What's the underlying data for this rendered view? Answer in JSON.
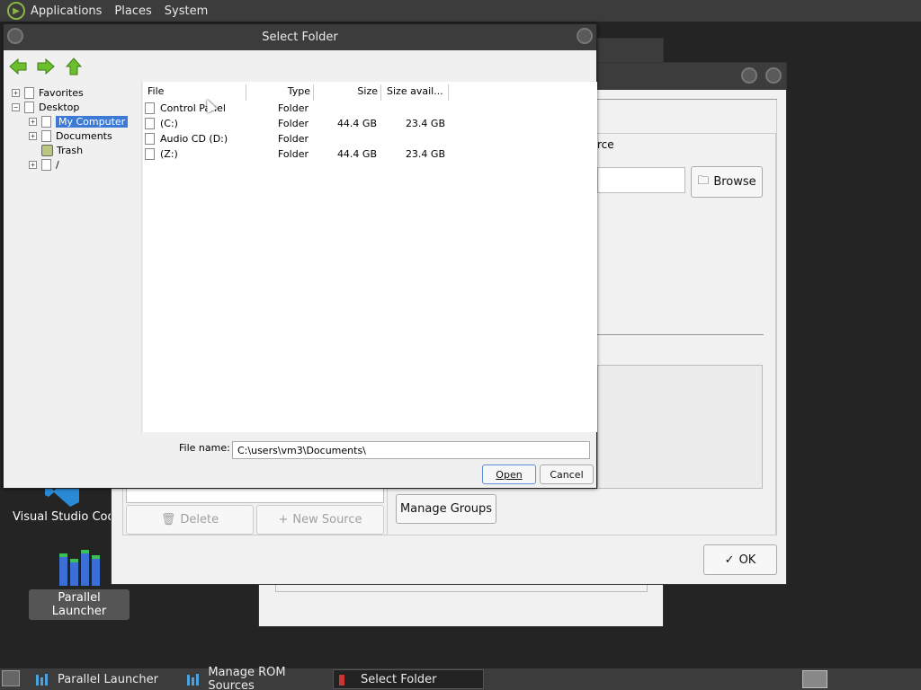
{
  "top_panel": {
    "menus": [
      "Applications",
      "Places",
      "System"
    ]
  },
  "desktop_icons": {
    "vscode_label": "Visual Studio Code",
    "launcher_label": "Parallel Launcher"
  },
  "rom_sources_window": {
    "tab_partial": "rce",
    "browse_label": "Browse",
    "delete_label": "Delete",
    "new_source_label": "New Source",
    "manage_groups_label": "Manage Groups",
    "ok_label": "OK"
  },
  "dialog": {
    "title": "Select Folder",
    "tree": {
      "favorites": "Favorites",
      "desktop": "Desktop",
      "my_computer": "My Computer",
      "documents": "Documents",
      "trash": "Trash",
      "root": "/"
    },
    "columns": {
      "file": "File",
      "type": "Type",
      "size": "Size",
      "size_avail": "Size avail..."
    },
    "rows": [
      {
        "name": "Control Panel",
        "type": "Folder",
        "size": "",
        "avail": ""
      },
      {
        "name": "(C:)",
        "type": "Folder",
        "size": "44.4 GB",
        "avail": "23.4 GB"
      },
      {
        "name": "Audio CD (D:)",
        "type": "Folder",
        "size": "",
        "avail": ""
      },
      {
        "name": "(Z:)",
        "type": "Folder",
        "size": "44.4 GB",
        "avail": "23.4 GB"
      }
    ],
    "filename_label": "File name:",
    "filename_value": "C:\\users\\vm3\\Documents\\",
    "open_label": "Open",
    "cancel_label": "Cancel"
  },
  "taskbar": {
    "tasks": [
      "Parallel Launcher",
      "Manage ROM Sources",
      "Select Folder"
    ]
  }
}
